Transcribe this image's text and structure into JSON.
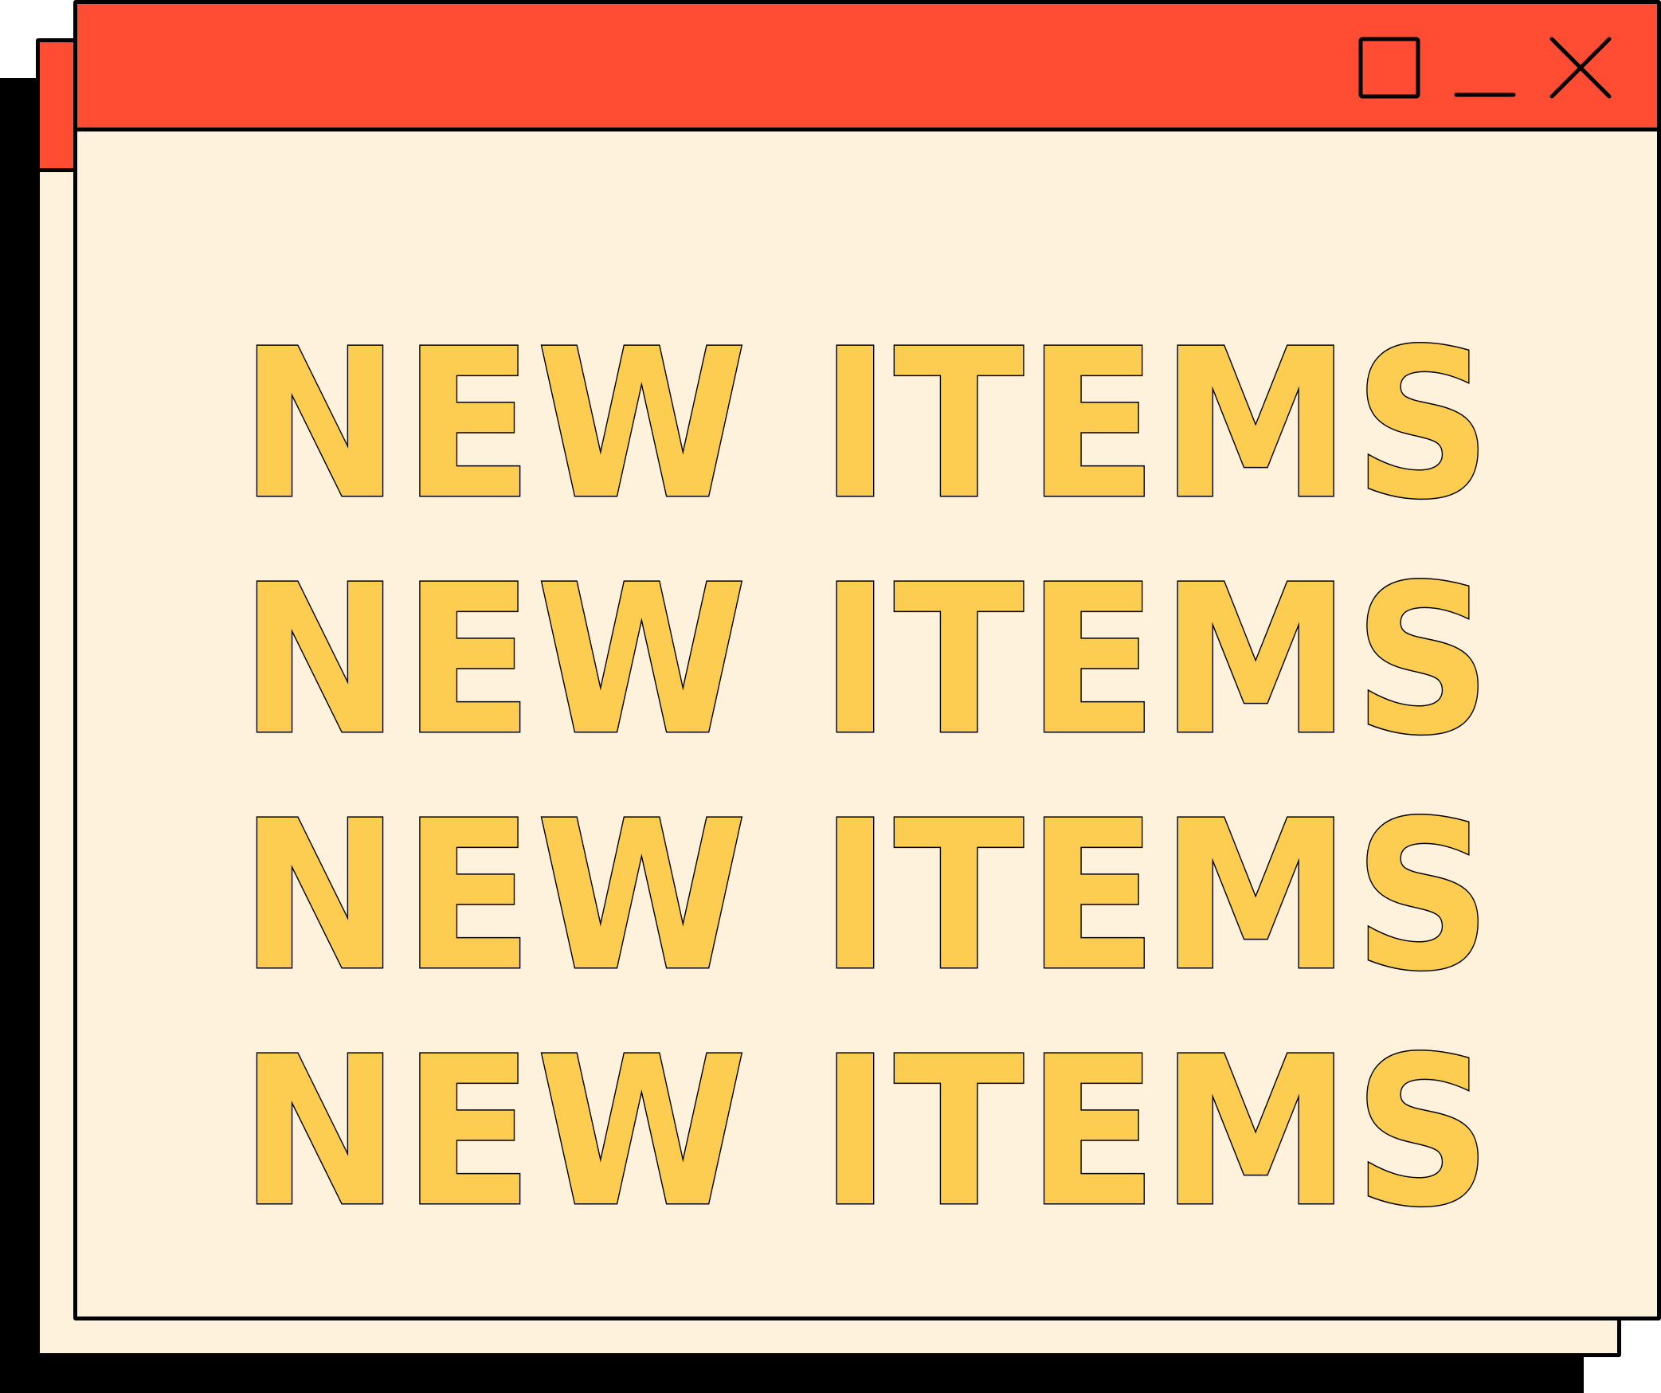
{
  "theme": {
    "titlebar_color": "#FF4D33",
    "content_color": "#FFF2DC",
    "text_color": "#FDCD52",
    "outline_color": "#000000"
  },
  "window": {
    "controls": [
      {
        "name": "maximize",
        "icon": "square-icon"
      },
      {
        "name": "minimize",
        "icon": "minus-icon"
      },
      {
        "name": "close",
        "icon": "x-icon"
      }
    ],
    "lines": [
      "NEW ITEMS",
      "NEW ITEMS",
      "NEW ITEMS",
      "NEW ITEMS"
    ]
  }
}
